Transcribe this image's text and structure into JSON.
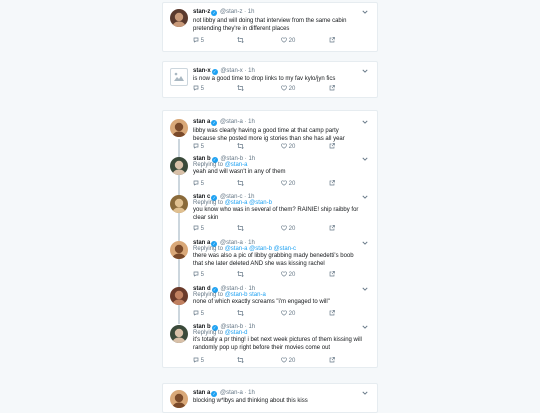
{
  "verified_badge": "✓",
  "colors": {
    "accent": "#1da1f2",
    "muted": "#657786",
    "background": "#f5f8fa"
  },
  "tweets": [
    {
      "name": "stan-z",
      "handle": "@stan-z",
      "dot": "·",
      "time": "1h",
      "text": "not libby and will doing that interview from the same cabin pretending they're in different places",
      "replies": "5",
      "likes": "20",
      "avatar": "photo-avatar"
    },
    {
      "name": "stan-x",
      "handle": "@stan-x",
      "dot": "·",
      "time": "1h",
      "text": "is now a good time to drop links to my fav kylo/jyn fics",
      "replies": "5",
      "likes": "20",
      "avatar": "broken-image-avatar"
    },
    {
      "name": "stan a",
      "handle": "@stan-a",
      "dot": "·",
      "time": "1h",
      "text": "libby was clearly having a good time at that camp party because she posted more ig stories than she has all year",
      "replies": "5",
      "likes": "20",
      "avatar": "photo-avatar"
    },
    {
      "name": "stan b",
      "handle": "@stan-b",
      "dot": "·",
      "time": "1h",
      "reply_prefix": "Replying to",
      "reply_to": "@stan-a",
      "text": "yeah and will wasn't in any of them",
      "replies": "5",
      "likes": "20",
      "avatar": "photo-avatar"
    },
    {
      "name": "stan c",
      "handle": "@stan-c",
      "dot": "·",
      "time": "1h",
      "reply_prefix": "Replying to",
      "reply_to": "@stan-a @stan-b",
      "text": "you know who was in several of them? RAINIE! ship raibby for clear skin",
      "replies": "5",
      "likes": "20",
      "avatar": "photo-avatar"
    },
    {
      "name": "stan a",
      "handle": "@stan-a",
      "dot": "·",
      "time": "1h",
      "reply_prefix": "Replying to",
      "reply_to": "@stan-a @stan-b @stan-c",
      "text": "there was also a pic of libby grabbing mady benedetti's boob that she later deleted AND she was kissing rachel",
      "replies": "5",
      "likes": "20",
      "avatar": "photo-avatar"
    },
    {
      "name": "stan d",
      "handle": "@stan-d",
      "dot": "·",
      "time": "1h",
      "reply_prefix": "Replying to",
      "reply_to": "@stan-b stan-a",
      "text": "none of which exactly screams \"i'm engaged to will\"",
      "replies": "5",
      "likes": "20",
      "avatar": "photo-avatar"
    },
    {
      "name": "stan b",
      "handle": "@stan-b",
      "dot": "·",
      "time": "1h",
      "reply_prefix": "Replying to",
      "reply_to": "@stan-d",
      "text": "it's totally a pr thing! i bet next week pictures of them kissing will randomly pop up right before their movies come out",
      "replies": "5",
      "likes": "20",
      "avatar": "photo-avatar"
    },
    {
      "name": "stan a",
      "handle": "@stan-a",
      "dot": "·",
      "time": "1h",
      "text": "blocking w*lbys and thinking about this kiss",
      "avatar": "photo-avatar"
    }
  ]
}
